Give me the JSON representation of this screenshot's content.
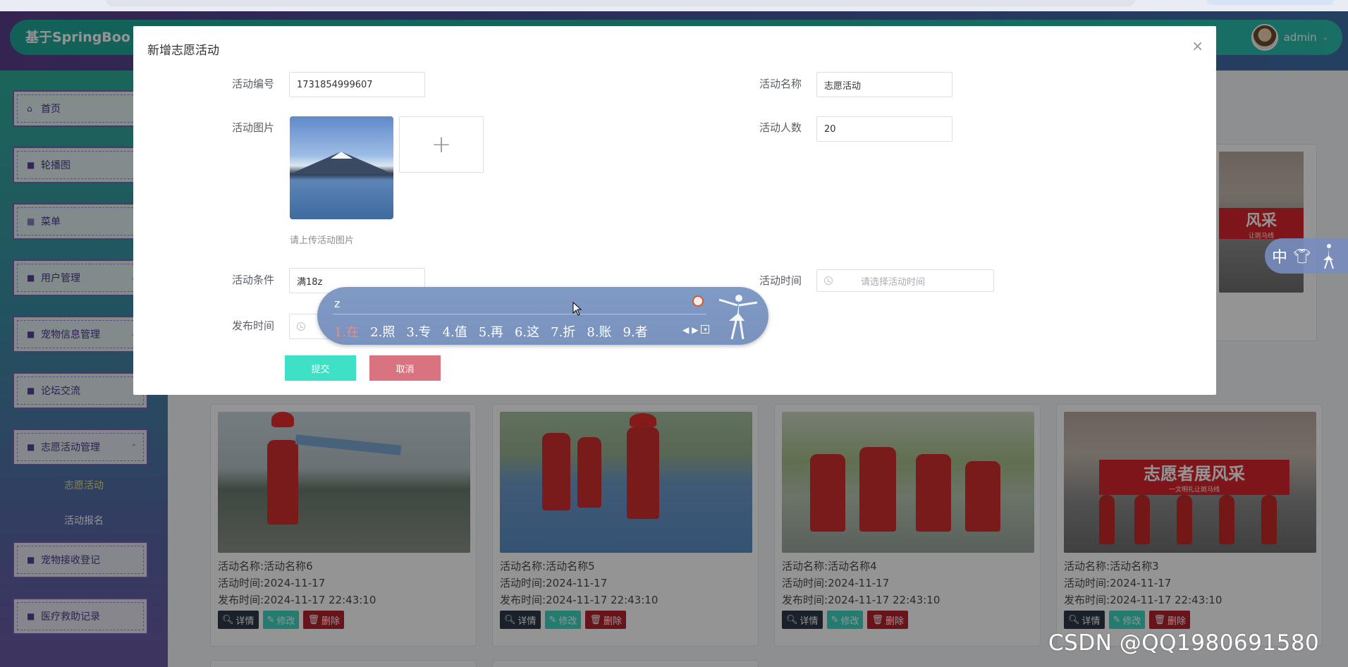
{
  "header": {
    "brand_title": "基于SpringBoo",
    "username": "admin"
  },
  "sidebar": {
    "items": [
      {
        "label": "首页",
        "icon": "home-icon"
      },
      {
        "label": "轮播图",
        "icon": "square-icon"
      },
      {
        "label": "菜单",
        "icon": "grid-icon"
      },
      {
        "label": "用户管理",
        "icon": "square-icon"
      },
      {
        "label": "宠物信息管理",
        "icon": "square-icon"
      },
      {
        "label": "论坛交流",
        "icon": "square-icon"
      },
      {
        "label": "志愿活动管理",
        "icon": "square-icon"
      },
      {
        "label": "宠物接收登记",
        "icon": "square-icon"
      },
      {
        "label": "医疗救助记录",
        "icon": "square-icon"
      }
    ],
    "sub_items": [
      "志愿活动",
      "活动报名"
    ]
  },
  "cards": [
    {
      "name_label": "活动名称:",
      "name": "活动名称6",
      "time_label": "活动时间:",
      "time": "2024-11-17",
      "pub_label": "发布时间:",
      "pub": "2024-11-17 22:43:10"
    },
    {
      "name_label": "活动名称:",
      "name": "活动名称5",
      "time_label": "活动时间:",
      "time": "2024-11-17",
      "pub_label": "发布时间:",
      "pub": "2024-11-17 22:43:10"
    },
    {
      "name_label": "活动名称:",
      "name": "活动名称4",
      "time_label": "活动时间:",
      "time": "2024-11-17",
      "pub_label": "发布时间:",
      "pub": "2024-11-17 22:43:10"
    },
    {
      "name_label": "活动名称:",
      "name": "活动名称3",
      "time_label": "活动时间:",
      "time": "2024-11-17",
      "pub_label": "发布时间:",
      "pub": "2024-11-17 22:43:10"
    }
  ],
  "card_buttons": {
    "detail": "详情",
    "edit": "修改",
    "delete": "删除"
  },
  "banner_text": "志愿者展风采",
  "banner_sub": "一文明礼让斑马线",
  "banner_top_text": "风采",
  "banner_top_sub": "让斑马线",
  "peek_value": "0",
  "dialog": {
    "title": "新增志愿活动",
    "fields": {
      "code_label": "活动编号",
      "code_value": "1731854999607",
      "name_label": "活动名称",
      "name_value": "志愿活动",
      "image_label": "活动图片",
      "count_label": "活动人数",
      "count_value": "20",
      "upload_tip": "请上传活动图片",
      "condition_label": "活动条件",
      "condition_value": "满18z",
      "time_label": "活动时间",
      "time_placeholder": "请选择活动时间",
      "publish_label": "发布时间"
    },
    "submit_label": "提交",
    "cancel_label": "取消"
  },
  "ime": {
    "composition": "z",
    "candidates": [
      "1.在",
      "2.照",
      "3.专",
      "4.值",
      "5.再",
      "6.这",
      "7.折",
      "8.账",
      "9.者"
    ],
    "status_char": "中"
  },
  "watermark": "CSDN @QQ1980691580",
  "colors": {
    "header_teal": "#25b3a3",
    "submit": "#3ee0c6",
    "cancel": "#d9737f",
    "delete": "#b4232f",
    "edit": "#3ed6c1"
  }
}
